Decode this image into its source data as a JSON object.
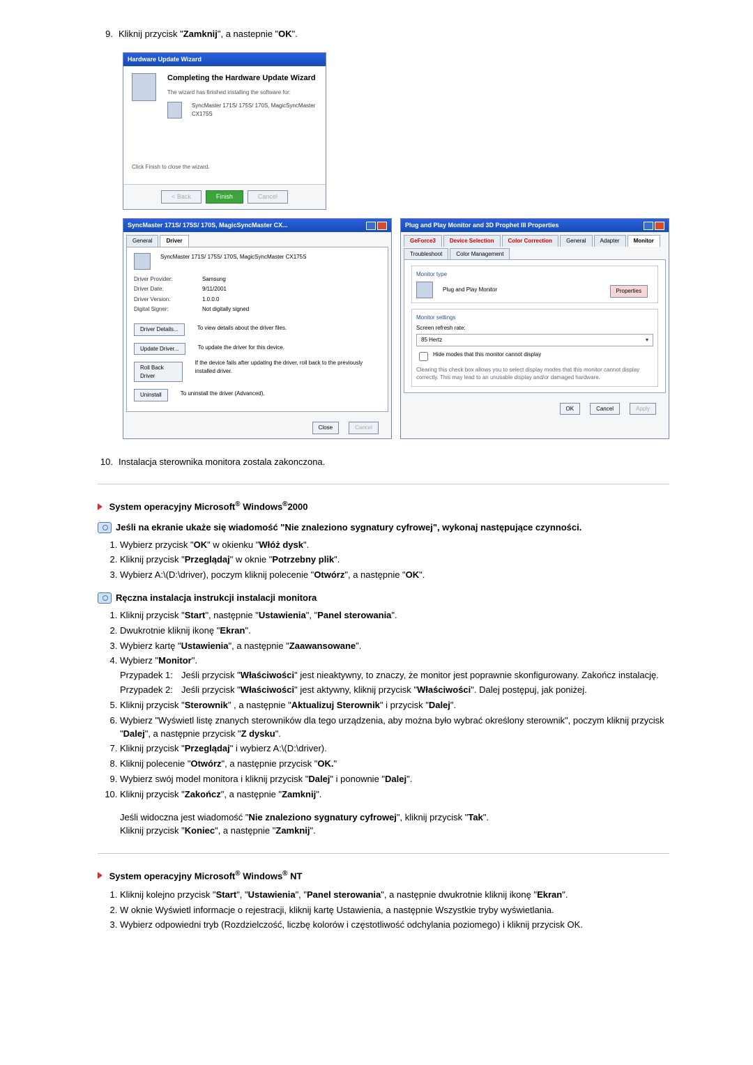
{
  "step9": {
    "num": "9.",
    "text_a": "Kliknij przycisk \"",
    "bold1": "Zamknij",
    "mid": "\", a nastepnie \"",
    "bold2": "OK",
    "end": "\"."
  },
  "wizard": {
    "title": "Hardware Update Wizard",
    "heading": "Completing the Hardware Update Wizard",
    "sub": "The wizard has finished installing the software for:",
    "device": "SyncMaster 171S/ 175S/ 170S, MagicSyncMaster CX175S",
    "click": "Click Finish to close the wizard.",
    "back": "< Back",
    "finish": "Finish",
    "cancel": "Cancel"
  },
  "driver": {
    "title": "SyncMaster 171S/ 175S/ 170S, MagicSyncMaster CX...",
    "tab_general": "General",
    "tab_driver": "Driver",
    "device": "SyncMaster 171S/ 175S/ 170S, MagicSyncMaster CX175S",
    "provider_k": "Driver Provider:",
    "provider_v": "Samsung",
    "date_k": "Driver Date:",
    "date_v": "9/11/2001",
    "version_k": "Driver Version:",
    "version_v": "1.0.0.0",
    "signer_k": "Digital Signer:",
    "signer_v": "Not digitally signed",
    "details_btn": "Driver Details...",
    "details_txt": "To view details about the driver files.",
    "update_btn": "Update Driver...",
    "update_txt": "To update the driver for this device.",
    "rollback_btn": "Roll Back Driver",
    "rollback_txt": "If the device fails after updating the driver, roll back to the previously installed driver.",
    "uninstall_btn": "Uninstall",
    "uninstall_txt": "To uninstall the driver (Advanced).",
    "close": "Close",
    "cancel": "Cancel"
  },
  "props": {
    "title": "Plug and Play Monitor and 3D Prophet III Properties",
    "tabs": {
      "geforce": "GeForce3",
      "devsel": "Device Selection",
      "colorcorr": "Color Correction",
      "general": "General",
      "adapter": "Adapter",
      "monitor": "Monitor",
      "trouble": "Troubleshoot",
      "colormgmt": "Color Management"
    },
    "montype_label": "Monitor type",
    "montype": "Plug and Play Monitor",
    "props_btn": "Properties",
    "settings_label": "Monitor settings",
    "refresh_label": "Screen refresh rate:",
    "refresh_val": "85 Hertz",
    "hide": "Hide modes that this monitor cannot display",
    "hide_note": "Clearing this check box allows you to select display modes that this monitor cannot display correctly. This may lead to an unusable display and/or damaged hardware.",
    "ok": "OK",
    "cancel": "Cancel",
    "apply": "Apply"
  },
  "step10": {
    "num": "10.",
    "text": "Instalacja sterownika monitora zostala zakonczona."
  },
  "sec2000": {
    "heading_a": "System operacyjny Microsoft",
    "heading_b": " Windows",
    "heading_c": "2000",
    "sig_a": "Jeśli na ekranie ukaże się wiadomość \"Nie znaleziono sygnatury cyfrowej\", wykonaj następujące czynności.",
    "li1_a": "Wybierz przycisk \"",
    "li1_b": "OK",
    "li1_c": "\" w okienku \"",
    "li1_d": "Włóż dysk",
    "li1_e": "\".",
    "li2_a": "Kliknij przycisk \"",
    "li2_b": "Przeglądaj",
    "li2_c": "\" w oknie \"",
    "li2_d": "Potrzebny plik",
    "li2_e": "\".",
    "li3_a": "Wybierz A:\\(D:\\driver), poczym kliknij polecenie \"",
    "li3_b": "Otwórz",
    "li3_c": "\", a następnie \"",
    "li3_d": "OK",
    "li3_e": "\".",
    "manual": "Ręczna instalacja instrukcji instalacji monitora",
    "m1_a": "Kliknij przycisk \"",
    "m1_b": "Start",
    "m1_c": "\", następnie \"",
    "m1_d": "Ustawienia",
    "m1_e": "\", \"",
    "m1_f": "Panel sterowania",
    "m1_g": "\".",
    "m2_a": "Dwukrotnie kliknij ikonę \"",
    "m2_b": "Ekran",
    "m2_c": "\".",
    "m3_a": "Wybierz kartę \"",
    "m3_b": "Ustawienia",
    "m3_c": "\", a następnie \"",
    "m3_d": "Zaawansowane",
    "m3_e": "\".",
    "m4_a": "Wybierz \"",
    "m4_b": "Monitor",
    "m4_c": "\".",
    "case1_lbl": "Przypadek 1:",
    "case1_a": "Jeśli przycisk \"",
    "case1_b": "Właściwości",
    "case1_c": "\" jest nieaktywny, to znaczy, że monitor jest poprawnie skonfigurowany. Zakończ instalację.",
    "case2_lbl": "Przypadek 2:",
    "case2_a": "Jeśli przycisk \"",
    "case2_b": "Właściwości",
    "case2_c": "\" jest aktywny, kliknij przycisk \"",
    "case2_d": "Właściwości",
    "case2_e": "\". Dalej postępuj, jak poniżej.",
    "m5_a": "Kliknij przycisk \"",
    "m5_b": "Sterownik",
    "m5_c": "\" , a następnie \"",
    "m5_d": "Aktualizuj Sterownik",
    "m5_e": "\" i przycisk \"",
    "m5_f": "Dalej",
    "m5_g": "\".",
    "m6_a": "Wybierz \"Wyświetl listę znanych sterowników dla tego urządzenia, aby można było wybrać określony sterownik\", poczym kliknij przycisk \"",
    "m6_b": "Dalej",
    "m6_c": "\", a następnie przycisk \"",
    "m6_d": "Z dysku",
    "m6_e": "\".",
    "m7_a": "Kliknij przycisk \"",
    "m7_b": "Przeglądaj",
    "m7_c": "\" i wybierz A:\\(D:\\driver).",
    "m8_a": "Kliknij polecenie \"",
    "m8_b": "Otwórz",
    "m8_c": "\", a następnie przycisk \"",
    "m8_d": "OK.",
    "m8_e": "\"",
    "m9_a": "Wybierz swój model monitora i kliknij przycisk \"",
    "m9_b": "Dalej",
    "m9_c": "\" i ponownie \"",
    "m9_d": "Dalej",
    "m9_e": "\".",
    "m10_a": "Kliknij przycisk \"",
    "m10_b": "Zakończ",
    "m10_c": "\", a następnie \"",
    "m10_d": "Zamknij",
    "m10_e": "\".",
    "tail1_a": "Jeśli widoczna jest wiadomość \"",
    "tail1_b": "Nie znaleziono sygnatury cyfrowej",
    "tail1_c": "\", kliknij przycisk \"",
    "tail1_d": "Tak",
    "tail1_e": "\".",
    "tail2_a": "Kliknij przycisk \"",
    "tail2_b": "Koniec",
    "tail2_c": "\", a następnie \"",
    "tail2_d": "Zamknij",
    "tail2_e": "\"."
  },
  "secNT": {
    "heading_a": "System operacyjny Microsoft",
    "heading_b": " Windows",
    "heading_c": " NT",
    "li1_a": "Kliknij kolejno przycisk \"",
    "li1_b": "Start",
    "li1_c": "\", \"",
    "li1_d": "Ustawienia",
    "li1_e": "\", \"",
    "li1_f": "Panel sterowania",
    "li1_g": "\", a następnie dwukrotnie kliknij ikonę \"",
    "li1_h": "Ekran",
    "li1_i": "\".",
    "li2": "W oknie Wyświetl informacje o rejestracji, kliknij kartę Ustawienia, a następnie Wszystkie tryby wyświetlania.",
    "li3": "Wybierz odpowiedni tryb (Rozdzielczość, liczbę kolorów i częstotliwość odchylania poziomego) i kliknij przycisk OK."
  }
}
